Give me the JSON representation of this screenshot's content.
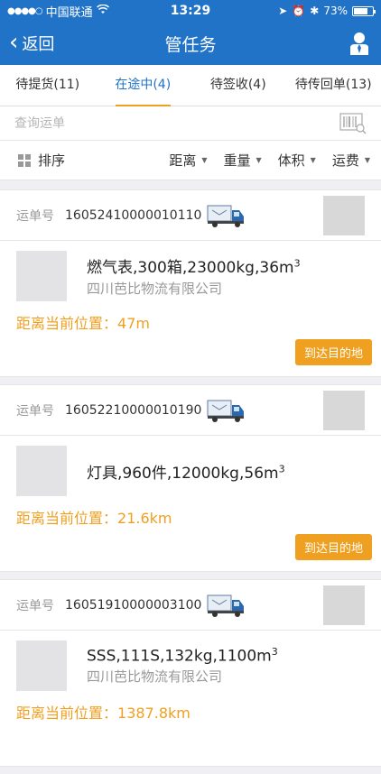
{
  "status": {
    "carrier": "中国联通",
    "time": "13:29",
    "battery": "73%",
    "battery_level": 0.73
  },
  "nav": {
    "back_label": "返回",
    "title": "管任务"
  },
  "tabs": [
    {
      "label": "待提货(11)"
    },
    {
      "label": "在途中(4)"
    },
    {
      "label": "待签收(4)"
    },
    {
      "label": "待传回单(13)"
    }
  ],
  "search": {
    "placeholder": "查询运单"
  },
  "sort": {
    "label": "排序",
    "filters": [
      {
        "label": "距离"
      },
      {
        "label": "重量"
      },
      {
        "label": "体积"
      },
      {
        "label": "运费"
      }
    ]
  },
  "orders": [
    {
      "no_label": "运单号",
      "no": "16052410000010110",
      "goods": "燃气表,300箱,23000kg,36m",
      "unit_sup": "3",
      "company": "四川芭比物流有限公司",
      "distance_label": "距离当前位置：",
      "distance": "47m",
      "action": "到达目的地"
    },
    {
      "no_label": "运单号",
      "no": "16052210000010190",
      "goods": "灯具,960件,12000kg,56m",
      "unit_sup": "3",
      "company": "",
      "distance_label": "距离当前位置：",
      "distance": "21.6km",
      "action": "到达目的地"
    },
    {
      "no_label": "运单号",
      "no": "16051910000003100",
      "goods": "SSS,111S,132kg,1100m",
      "unit_sup": "3",
      "company": "四川芭比物流有限公司",
      "distance_label": "距离当前位置：",
      "distance": "1387.8km",
      "action": ""
    }
  ]
}
